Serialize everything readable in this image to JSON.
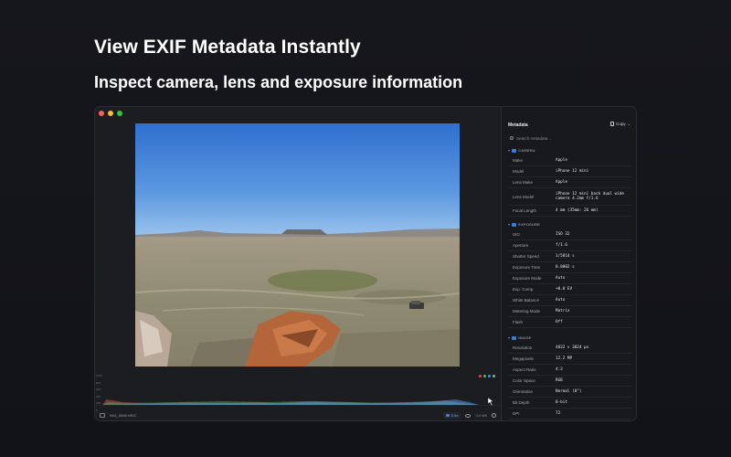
{
  "headline": "View EXIF Metadata Instantly",
  "subheadline": "Inspect camera, lens and exposure information",
  "viewer": {
    "file_name": "IMG_0598.HEIC",
    "zoom": "0.9x",
    "file_size": "3.5 MB",
    "histogram_scale": [
      "1000",
      "800",
      "600",
      "400",
      "200",
      "0"
    ]
  },
  "panel": {
    "title": "Metadata",
    "copy_label": "Copy",
    "search_placeholder": "Search metadata...",
    "sections": [
      {
        "title": "CAMERA",
        "rows": [
          {
            "key": "Make",
            "value": "Apple"
          },
          {
            "key": "Model",
            "value": "iPhone 12 mini"
          },
          {
            "key": "Lens Make",
            "value": "Apple"
          },
          {
            "key": "Lens Model",
            "value": "iPhone 12 mini back dual wide camera 4.2mm f/1.6"
          },
          {
            "key": "Focal Length",
            "value": "4 mm  (35mm: 26 mm)"
          }
        ]
      },
      {
        "title": "EXPOSURE",
        "rows": [
          {
            "key": "ISO",
            "value": "ISO 32"
          },
          {
            "key": "Aperture",
            "value": "f/1.6"
          },
          {
            "key": "Shutter Speed",
            "value": "1/5814 s"
          },
          {
            "key": "Exposure Time",
            "value": "0.0002 s"
          },
          {
            "key": "Exposure Mode",
            "value": "Auto"
          },
          {
            "key": "Exp. Comp.",
            "value": "+0.0 EV"
          },
          {
            "key": "White Balance",
            "value": "Auto"
          },
          {
            "key": "Metering Mode",
            "value": "Matrix"
          },
          {
            "key": "Flash",
            "value": "Off"
          }
        ]
      },
      {
        "title": "IMAGE",
        "rows": [
          {
            "key": "Resolution",
            "value": "4032 × 3024 px"
          },
          {
            "key": "Megapixels",
            "value": "12.2 MP"
          },
          {
            "key": "Aspect Ratio",
            "value": "4:3"
          },
          {
            "key": "Color Space",
            "value": "RGB"
          },
          {
            "key": "Orientation",
            "value": "Normal (0°)"
          },
          {
            "key": "Bit Depth",
            "value": "8-bit"
          },
          {
            "key": "DPI",
            "value": "72"
          }
        ]
      }
    ]
  },
  "colors": {
    "accent": "#3a7bd5",
    "histogram_red": "#e0484f",
    "histogram_green": "#3fbf6a",
    "histogram_blue": "#3f8fe0"
  }
}
